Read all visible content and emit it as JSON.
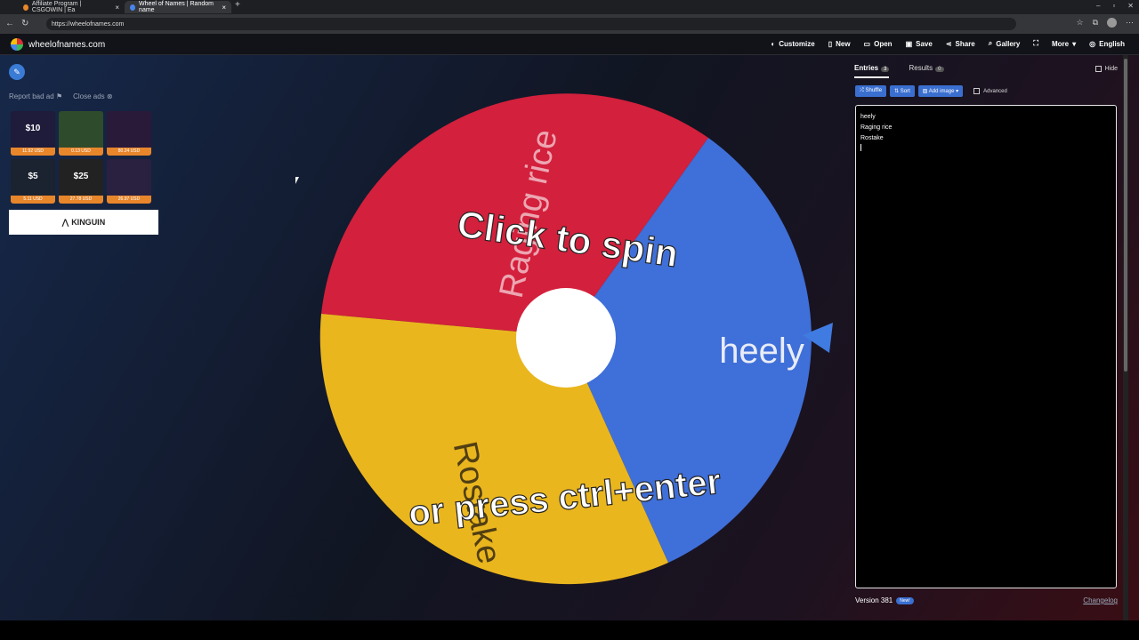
{
  "browser": {
    "tabs": [
      {
        "title": "Affiliate Program | CSGOWIN | Ea",
        "active": false
      },
      {
        "title": "Wheel of Names | Random name",
        "active": true
      }
    ],
    "url": "https://wheelofnames.com"
  },
  "header": {
    "site_name": "wheelofnames.com",
    "menu": [
      "Customize",
      "New",
      "Open",
      "Save",
      "Share",
      "Gallery",
      "More",
      "English"
    ]
  },
  "ads": {
    "report_label": "Report bad ad",
    "close_label": "Close ads",
    "cards": [
      {
        "amount": "$10",
        "price": "11.92 USD"
      },
      {
        "amount": "",
        "price": "0.13 USD"
      },
      {
        "amount": "",
        "price": "80.24 USD"
      },
      {
        "amount": "$5",
        "price": "5.11 USD"
      },
      {
        "amount": "$25",
        "price": "27.78 USD"
      },
      {
        "amount": "",
        "price": "26.97 USD"
      }
    ],
    "banner": "KINGUIN"
  },
  "wheel": {
    "prompt_top": "Click to spin",
    "prompt_bottom": "or press ctrl+enter",
    "segments": [
      {
        "label": "Raging rice",
        "color": "#d3203c"
      },
      {
        "label": "heely",
        "color": "#3f6fd8"
      },
      {
        "label": "Rostake",
        "color": "#eab61e"
      }
    ]
  },
  "panel": {
    "tabs": [
      {
        "label": "Entries",
        "count": "3"
      },
      {
        "label": "Results",
        "count": "0"
      }
    ],
    "hide_label": "Hide",
    "buttons": [
      "Shuffle",
      "Sort",
      "Add image"
    ],
    "advanced_label": "Advanced",
    "entries": [
      "heely",
      "Raging rice",
      "Rostake"
    ],
    "version": "Version 381",
    "new_badge": "New!",
    "changelog": "Changelog"
  },
  "colors": {
    "accent": "#3a6fd0",
    "red": "#d3203c",
    "blue": "#3f6fd8",
    "yellow": "#eab61e"
  }
}
